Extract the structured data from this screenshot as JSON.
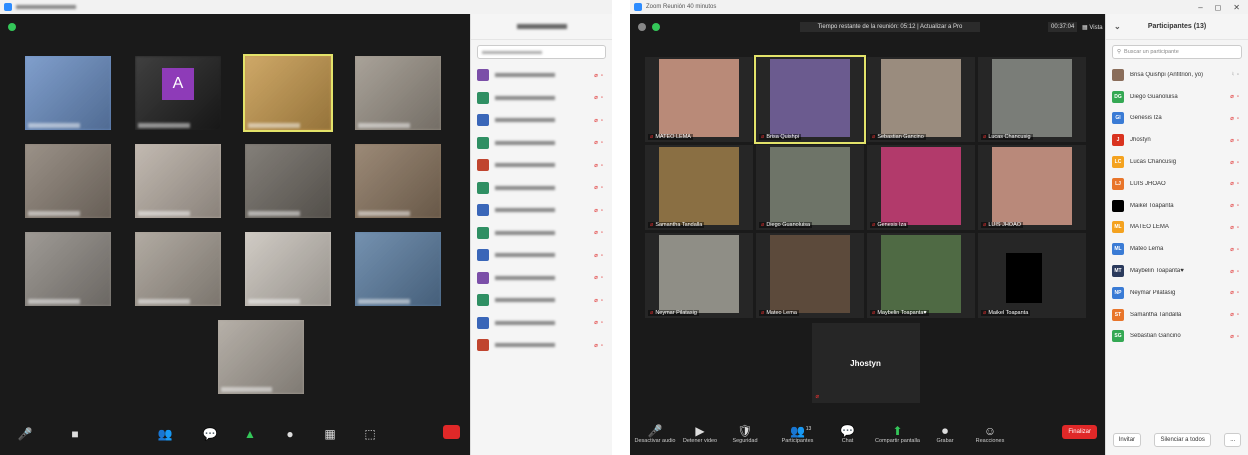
{
  "left_window": {
    "participants_rows": [
      {
        "avatar_color": "#7b4fa8"
      },
      {
        "avatar_color": "#2f8f63"
      },
      {
        "avatar_color": "#3a66b8"
      },
      {
        "avatar_color": "#2f8f63"
      },
      {
        "avatar_color": "#c0452f"
      },
      {
        "avatar_color": "#2f8f63"
      },
      {
        "avatar_color": "#3a66b8"
      },
      {
        "avatar_color": "#2f8f63"
      },
      {
        "avatar_color": "#3a66b8"
      },
      {
        "avatar_color": "#7b4fa8"
      },
      {
        "avatar_color": "#2f8f63"
      },
      {
        "avatar_color": "#3a66b8"
      },
      {
        "avatar_color": "#c0452f"
      }
    ],
    "tiles": [
      {
        "bg": "#6b8fc4",
        "letter": ""
      },
      {
        "bg": "#1f1f1f",
        "letter": "A"
      },
      {
        "bg": "#c79a4e",
        "letter": ""
      },
      {
        "bg": "#9b9388",
        "letter": ""
      },
      {
        "bg": "#8a7f74",
        "letter": ""
      },
      {
        "bg": "#b8aea4",
        "letter": ""
      },
      {
        "bg": "#6f6a63",
        "letter": ""
      },
      {
        "bg": "#8b7660",
        "letter": ""
      },
      {
        "bg": "#8f8a84",
        "letter": ""
      },
      {
        "bg": "#a59d93",
        "letter": ""
      },
      {
        "bg": "#c9c3bb",
        "letter": ""
      },
      {
        "bg": "#5d7fa3",
        "letter": ""
      },
      {
        "bg": "#aaa39a",
        "letter": ""
      }
    ]
  },
  "right_window": {
    "title": "Zoom Reunión 40 minutos",
    "banner": "Tiempo restante de la reunión: 05:12 | Actualizar a Pro",
    "timer": "00:37:04",
    "view_label": "Vista",
    "window_controls": [
      "–",
      "◻",
      "✕"
    ],
    "tiles": [
      {
        "name": "MATEO LEMA",
        "bg": "#b98a78",
        "active": false
      },
      {
        "name": "Brisa Quishpi",
        "bg": "#6b5b8f",
        "active": true
      },
      {
        "name": "Sebastian Gancino",
        "bg": "#9a8c7e",
        "active": false
      },
      {
        "name": "Lucas Chancusig",
        "bg": "#7a7d78",
        "active": false
      },
      {
        "name": "Samantha Tandalla",
        "bg": "#8a6f43",
        "active": false
      },
      {
        "name": "Diego Guanoluisa",
        "bg": "#6e7468",
        "active": false
      },
      {
        "name": "Genesis Iza",
        "bg": "#b23a6b",
        "active": false
      },
      {
        "name": "LUIS JHOAO",
        "bg": "#b9897a",
        "active": false
      },
      {
        "name": "Neymar Pilatasig",
        "bg": "#8f8e86",
        "active": false
      },
      {
        "name": "Mateo Lema",
        "bg": "#5c4a3b",
        "active": false
      },
      {
        "name": "Maybelin Toapanta♥",
        "bg": "#4f6a44",
        "active": false
      },
      {
        "name": "Maikel Toapanta",
        "bg": "#000000",
        "active": false
      },
      {
        "name": "Jhostyn",
        "bg": "#1f1f1f",
        "active": false
      }
    ],
    "toolbar": [
      {
        "icon": "🎤",
        "label": "Desactivar audio"
      },
      {
        "icon": "▶",
        "label": "Detener video"
      },
      {
        "icon": "🛡",
        "label": "Seguridad"
      },
      {
        "icon": "👥",
        "label": "Participantes"
      },
      {
        "icon": "💬",
        "label": "Chat"
      },
      {
        "icon": "⬆",
        "label": "Compartir pantalla"
      },
      {
        "icon": "⏺",
        "label": "Grabar"
      },
      {
        "icon": "☺",
        "label": "Reacciones"
      }
    ],
    "participants_count": "13",
    "end_label": "Finalizar",
    "panel": {
      "title": "Participantes (13)",
      "search_placeholder": "Buscar un participante",
      "invite_label": "Invitar",
      "mute_all_label": "Silenciar a todos",
      "more_label": "...",
      "rows": [
        {
          "name": "Brisa Quishpi (Anfitrión, yo)",
          "initials": "",
          "color": "#8a6d5a",
          "muted": false
        },
        {
          "name": "Diego Guanoluisa",
          "initials": "DG",
          "color": "#34a853",
          "muted": true
        },
        {
          "name": "Genesis Iza",
          "initials": "GI",
          "color": "#3a7bd5",
          "muted": true
        },
        {
          "name": "Jhostyn",
          "initials": "J",
          "color": "#d9331f",
          "muted": true
        },
        {
          "name": "Lucas Chancusig",
          "initials": "LC",
          "color": "#f4a21f",
          "muted": true
        },
        {
          "name": "LUIS JHOAO",
          "initials": "LJ",
          "color": "#e8752a",
          "muted": true
        },
        {
          "name": "Maikel Toapanta",
          "initials": "",
          "color": "#000000",
          "muted": true
        },
        {
          "name": "MATEO LEMA",
          "initials": "ML",
          "color": "#f4a21f",
          "muted": true
        },
        {
          "name": "Mateo Lema",
          "initials": "ML",
          "color": "#3a7bd5",
          "muted": true
        },
        {
          "name": "Maybelin Toapanta♥",
          "initials": "MT",
          "color": "#2a3a5c",
          "muted": true
        },
        {
          "name": "Neymar Pilatasig",
          "initials": "NP",
          "color": "#3a7bd5",
          "muted": true
        },
        {
          "name": "Samantha Tandalla",
          "initials": "ST",
          "color": "#e8752a",
          "muted": true
        },
        {
          "name": "Sebastian Gancino",
          "initials": "SG",
          "color": "#34a853",
          "muted": true
        }
      ]
    }
  }
}
